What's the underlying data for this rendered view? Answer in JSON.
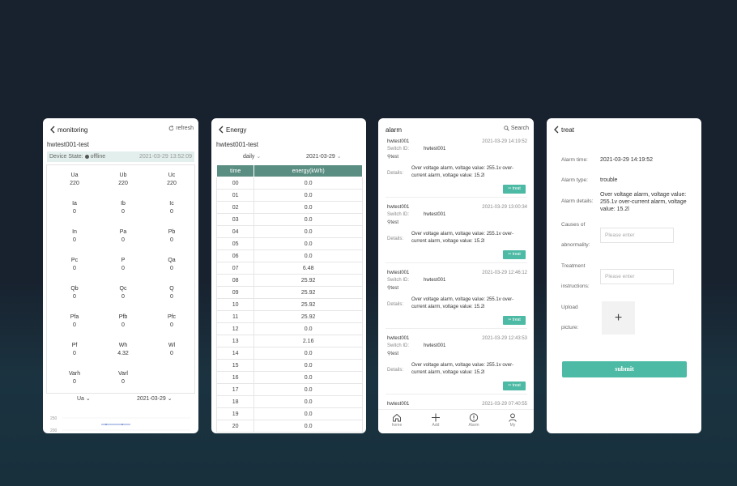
{
  "monitoring": {
    "title": "monitoring",
    "refresh": "refresh",
    "device_name": "hwtest001-test",
    "device_state_label": "Device State:",
    "device_state": "offline",
    "timestamp": "2021-03-29 13:52:09",
    "metrics": [
      {
        "label": "Ua",
        "value": "220"
      },
      {
        "label": "Ub",
        "value": "220"
      },
      {
        "label": "Uc",
        "value": "220"
      },
      {
        "label": "Ia",
        "value": "0"
      },
      {
        "label": "Ib",
        "value": "0"
      },
      {
        "label": "Ic",
        "value": "0"
      },
      {
        "label": "In",
        "value": "0"
      },
      {
        "label": "Pa",
        "value": "0"
      },
      {
        "label": "Pb",
        "value": "0"
      },
      {
        "label": "Pc",
        "value": "0"
      },
      {
        "label": "P",
        "value": "0"
      },
      {
        "label": "Qa",
        "value": "0"
      },
      {
        "label": "Qb",
        "value": "0"
      },
      {
        "label": "Qc",
        "value": "0"
      },
      {
        "label": "Q",
        "value": "0"
      },
      {
        "label": "Pfa",
        "value": "0"
      },
      {
        "label": "Pfb",
        "value": "0"
      },
      {
        "label": "Pfc",
        "value": "0"
      },
      {
        "label": "Pf",
        "value": "0"
      },
      {
        "label": "Wh",
        "value": "4.32"
      },
      {
        "label": "Wl",
        "value": "0"
      },
      {
        "label": "Varh",
        "value": "0"
      },
      {
        "label": "Varl",
        "value": "0"
      }
    ],
    "chart_selector": "Ua",
    "chart_date": "2021-03-29",
    "chart_ticks": [
      "250",
      "200"
    ]
  },
  "energy": {
    "title": "Energy",
    "device_name": "hwtest001-test",
    "period": "daily",
    "date": "2021-03-29",
    "columns": [
      "time",
      "energy(kWh)"
    ],
    "rows": [
      [
        "00",
        "0.0"
      ],
      [
        "01",
        "0.0"
      ],
      [
        "02",
        "0.0"
      ],
      [
        "03",
        "0.0"
      ],
      [
        "04",
        "0.0"
      ],
      [
        "05",
        "0.0"
      ],
      [
        "06",
        "0.0"
      ],
      [
        "07",
        "6.48"
      ],
      [
        "08",
        "25.92"
      ],
      [
        "09",
        "25.92"
      ],
      [
        "10",
        "25.92"
      ],
      [
        "11",
        "25.92"
      ],
      [
        "12",
        "0.0"
      ],
      [
        "13",
        "2.16"
      ],
      [
        "14",
        "0.0"
      ],
      [
        "15",
        "0.0"
      ],
      [
        "16",
        "0.0"
      ],
      [
        "17",
        "0.0"
      ],
      [
        "18",
        "0.0"
      ],
      [
        "19",
        "0.0"
      ],
      [
        "20",
        "0.0"
      ]
    ]
  },
  "alarm": {
    "title": "alarm",
    "search": "Search",
    "switch_label": "Switch ID:",
    "details_label": "Details:",
    "treat_label": "treat",
    "items": [
      {
        "name": "hwtest001",
        "time": "2021-03-29 14:19:52",
        "switch": "hwtest001",
        "location": "test",
        "details": "Over voltage alarm, voltage value: 255.1v over-current alarm, voltage value: 15.2l"
      },
      {
        "name": "hwtest001",
        "time": "2021-03-29 13:00:34",
        "switch": "hwtest001",
        "location": "test",
        "details": "Over voltage alarm, voltage value: 255.1v over-current alarm, voltage value: 15.2l"
      },
      {
        "name": "hwtest001",
        "time": "2021-03-29 12:46:12",
        "switch": "hwtest001",
        "location": "test",
        "details": "Over voltage alarm, voltage value: 255.1v over-current alarm, voltage value: 15.2l"
      },
      {
        "name": "hwtest001",
        "time": "2021-03-29 12:43:53",
        "switch": "hwtest001",
        "location": "test",
        "details": "Over voltage alarm, voltage value: 255.1v over-current alarm, voltage value: 15.2l"
      },
      {
        "name": "hwtest001",
        "time": "2021-03-29 07:40:55"
      }
    ],
    "tabs": [
      "home",
      "Add",
      "Alarm",
      "My"
    ]
  },
  "treat": {
    "title": "treat",
    "alarm_time_label": "Alarm time:",
    "alarm_time": "2021-03-29 14:19:52",
    "alarm_type_label": "Alarm type:",
    "alarm_type": "trouble",
    "alarm_details_label": "Alarm details:",
    "alarm_details": "Over voltage alarm, voltage value: 255.1v over-current alarm, voltage value: 15.2l",
    "causes_label_1": "Causes of",
    "causes_label_2": "abnormality:",
    "causes_placeholder": "Please enter",
    "treatment_label_1": "Treatment",
    "treatment_label_2": "instructions:",
    "treatment_placeholder": "Please enter",
    "upload_label_1": "Upload",
    "upload_label_2": "picture:",
    "upload_plus": "+",
    "submit": "submit"
  },
  "colors": {
    "accent": "#4cbaa4",
    "table_header": "#5b8e82",
    "state_bg": "#e2efec"
  }
}
